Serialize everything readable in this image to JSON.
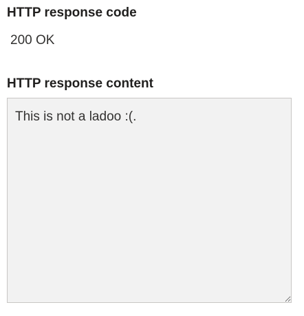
{
  "response_code": {
    "label": "HTTP response code",
    "value": "200 OK"
  },
  "response_content": {
    "label": "HTTP response content",
    "value": "This is not a ladoo :(."
  }
}
